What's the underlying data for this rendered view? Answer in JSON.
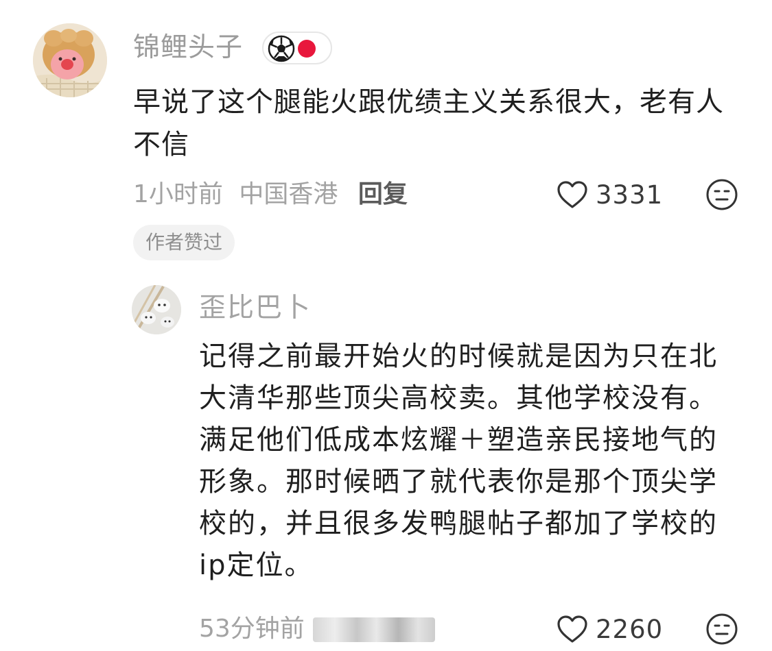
{
  "comment": {
    "username": "锦鲤头子",
    "badge_icons": [
      "soccer-ball-icon",
      "red-dot-icon"
    ],
    "text": "早说了这个腿能火跟优绩主义关系很大，老有人不信",
    "time": "1小时前",
    "location": "中国香港",
    "reply_label": "回复",
    "like_count": "3331",
    "author_liked_label": "作者赞过"
  },
  "reply": {
    "username": "歪比巴卜",
    "text_lines": [
      "记得之前最开始火的时候就是因为只在北",
      "大清华那些顶尖高校卖。其他学校没有。",
      "满足他们低成本炫耀＋塑造亲民接地气的",
      "形象。那时候晒了就代表你是那个顶尖学",
      "校的，并且很多发鸭腿帖子都加了学校的",
      "ip定位。"
    ],
    "time": "53分钟前",
    "like_count": "2260"
  },
  "colors": {
    "muted_text": "#a3a3a3",
    "body_text": "#1f1f1f",
    "badge_red": "#e8173c",
    "pill_bg": "#f2f2f2"
  }
}
